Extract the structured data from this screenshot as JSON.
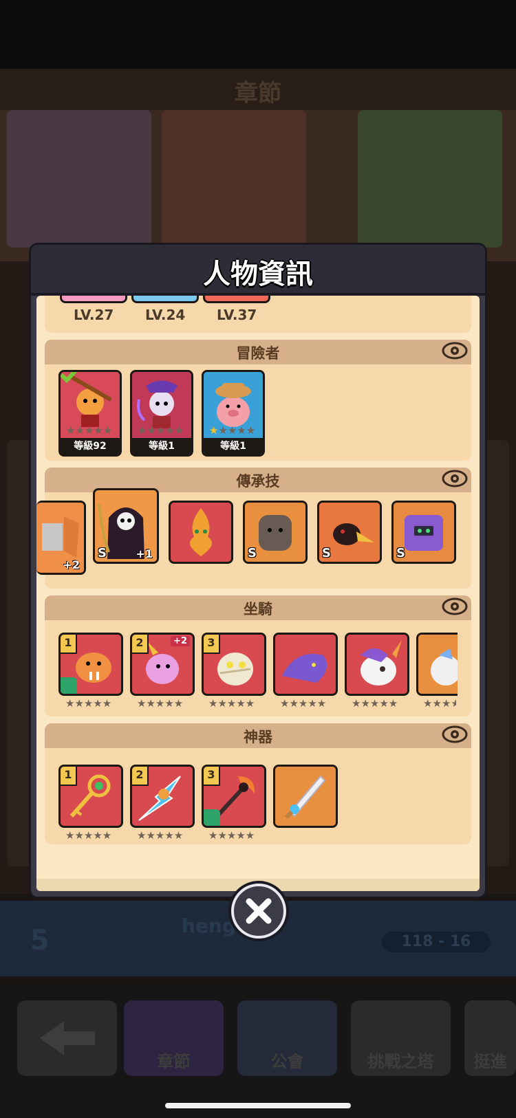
{
  "background": {
    "chapter_title": "章節",
    "rank": "5",
    "player_name": "heng",
    "score_range": "118 - 16",
    "nav": [
      "章節",
      "公會",
      "挑戰之塔",
      "挺進"
    ]
  },
  "modal": {
    "title": "人物資訊",
    "top_levels": [
      "LV.27",
      "LV.24",
      "LV.37"
    ],
    "sections": {
      "adventurers": {
        "title": "冒險者",
        "items": [
          {
            "caption": "等級92",
            "frame": "#c83a48"
          },
          {
            "caption": "等級1",
            "frame": "#c83a48"
          },
          {
            "caption": "等級1",
            "frame": "#2c8ec8"
          }
        ]
      },
      "legacy_skills": {
        "title": "傳承技",
        "items": [
          {
            "plus": "+2"
          },
          {
            "s": "S",
            "plus": "+1"
          },
          {
            "s": ""
          },
          {
            "s": "S"
          },
          {
            "s": "S"
          },
          {
            "s": "S"
          }
        ]
      },
      "mounts": {
        "title": "坐騎",
        "items": [
          {
            "num": "1"
          },
          {
            "num": "2",
            "plus": "+2"
          },
          {
            "num": "3"
          },
          {
            "num": ""
          },
          {
            "num": ""
          },
          {
            "num": ""
          }
        ]
      },
      "artifacts": {
        "title": "神器",
        "items": [
          {
            "num": "1"
          },
          {
            "num": "2"
          },
          {
            "num": "3"
          },
          {
            "num": ""
          }
        ]
      }
    },
    "stars": "★★★★★",
    "colors": {
      "red_frame": "#c83a48",
      "gold_frame": "#f0b43a",
      "blue_frame": "#2c8ec8",
      "section_header": "#d5b08a"
    }
  }
}
